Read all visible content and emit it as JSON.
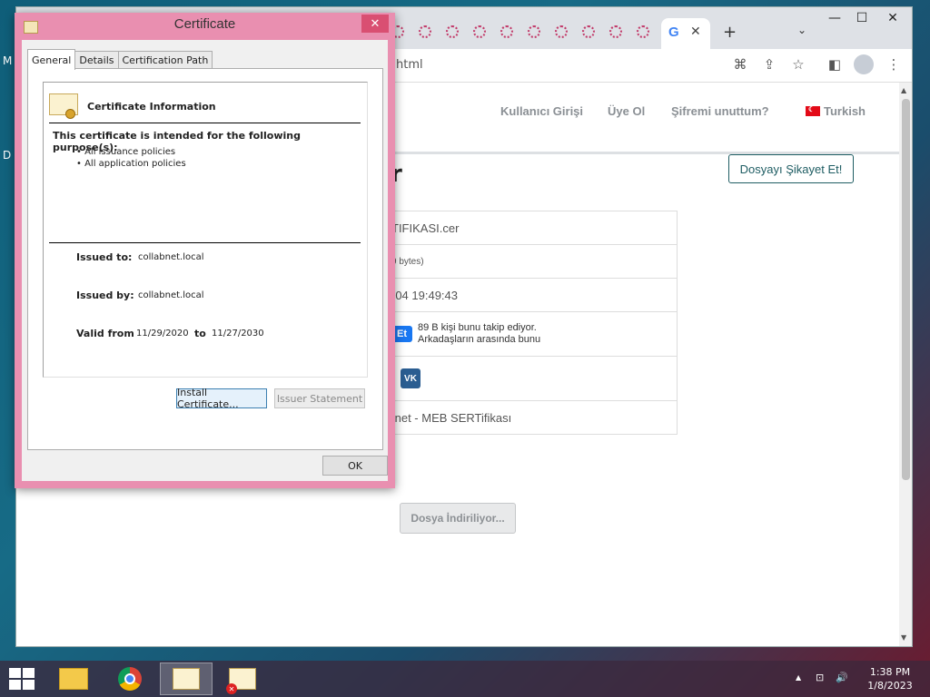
{
  "desktop": {
    "labels": [
      "M",
      "D"
    ]
  },
  "browser": {
    "tab_active_icon": "google-g-icon",
    "tab_close": "✕",
    "new_tab": "+",
    "url_fragment": "html",
    "window_controls": {
      "minimize": "—",
      "maximize": "☐",
      "close": "✕"
    }
  },
  "site": {
    "nav": {
      "login": "Kullanıcı Girişi",
      "register": "Üye Ol",
      "forgot": "Şifremi unuttum?",
      "language": "Turkish"
    },
    "heading_fragment": "r",
    "report_button": "Dosyayı Şikayet Et!",
    "info_rows": {
      "filename": "TIFIKASI.cer",
      "size": "9 bytes)",
      "date": "-04 19:49:43",
      "follow_button": "Et",
      "follow_line1": "89 B kişi bunu takip ediyor.",
      "follow_line2": "Arkadaşların arasında bunu",
      "vk": "VK",
      "source": ".net - MEB SERTifikası"
    },
    "download_button": "Dosya İndiriliyor..."
  },
  "dialog": {
    "title": "Certificate",
    "close": "✕",
    "tabs": [
      "General",
      "Details",
      "Certification Path"
    ],
    "info_title": "Certificate Information",
    "purpose_heading": "This certificate is intended for the following purpose(s):",
    "purposes": [
      "All issuance policies",
      "All application policies"
    ],
    "issued_to_label": "Issued to:",
    "issued_to": "collabnet.local",
    "issued_by_label": "Issued by:",
    "issued_by": "collabnet.local",
    "valid_from_label": "Valid from",
    "valid_from": "11/29/2020",
    "to_label": "to",
    "valid_to": "11/27/2030",
    "install_button": "Install Certificate...",
    "issuer_button": "Issuer Statement",
    "ok_button": "OK"
  },
  "taskbar": {
    "clock_time": "1:38 PM",
    "clock_date": "1/8/2023",
    "tray_arrow": "▲",
    "tray_network": "⊡",
    "tray_volume": "🔊"
  }
}
